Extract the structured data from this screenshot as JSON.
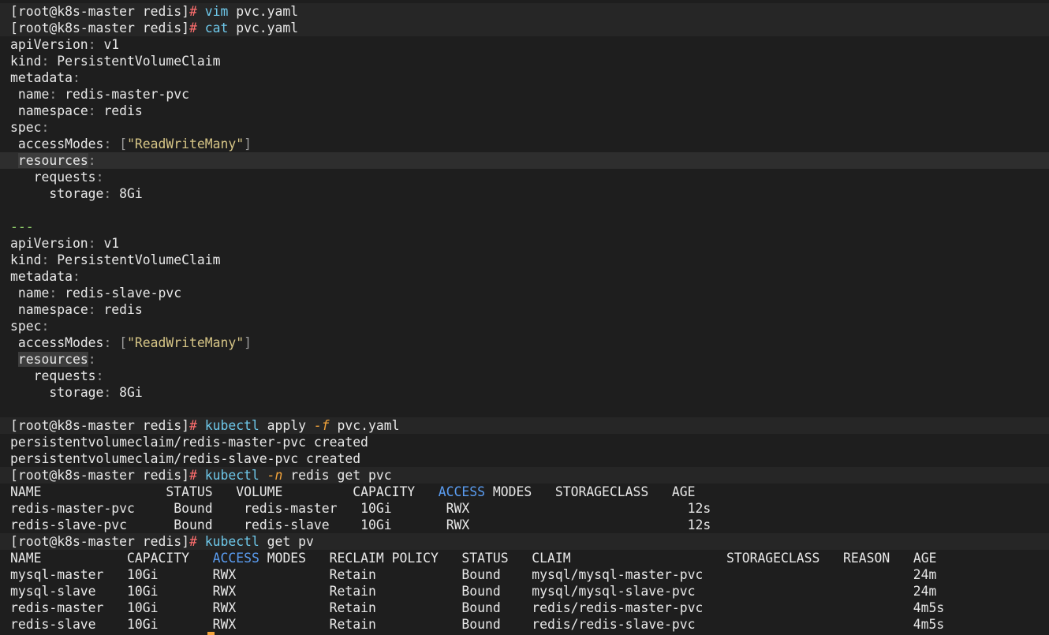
{
  "terminal": {
    "prompt": "[root@k8s-master redis]",
    "hash": "#",
    "cmd1": {
      "word": "vim",
      "arg": "pvc.yaml"
    },
    "cmd2": {
      "word": "cat",
      "arg": "pvc.yaml"
    },
    "doc1": {
      "apiVersion_key": "apiVersion",
      "apiVersion_val": "v1",
      "kind_key": "kind",
      "kind_val": "PersistentVolumeClaim",
      "metadata_key": "metadata",
      "name_key": "name",
      "name_val": "redis-master-pvc",
      "ns_key": "namespace",
      "ns_val": "redis",
      "spec_key": "spec",
      "am_key": "accessModes",
      "am_val": "\"ReadWriteMany\"",
      "res_key": "resources",
      "req_key": "requests",
      "storage_key": "storage",
      "storage_val": "8Gi"
    },
    "separator": "---",
    "doc2": {
      "apiVersion_key": "apiVersion",
      "apiVersion_val": "v1",
      "kind_key": "kind",
      "kind_val": "PersistentVolumeClaim",
      "metadata_key": "metadata",
      "name_key": "name",
      "name_val": "redis-slave-pvc",
      "ns_key": "namespace",
      "ns_val": "redis",
      "spec_key": "spec",
      "am_key": "accessModes",
      "am_val": "\"ReadWriteMany\"",
      "res_key": "resources",
      "req_key": "requests",
      "storage_key": "storage",
      "storage_val": "8Gi"
    },
    "cmd3": {
      "word": "kubectl",
      "sub": "apply",
      "flag": "-f",
      "arg": "pvc.yaml"
    },
    "out3": [
      "persistentvolumeclaim/redis-master-pvc created",
      "persistentvolumeclaim/redis-slave-pvc created"
    ],
    "cmd4": {
      "word": "kubectl",
      "flag": "-n",
      "arg": "redis get pvc"
    },
    "pvc_table": {
      "headers": {
        "name": "NAME",
        "status": "STATUS",
        "volume": "VOLUME",
        "capacity": "CAPACITY",
        "access": "ACCESS",
        "modes": "MODES",
        "storageclass": "STORAGECLASS",
        "age": "AGE"
      },
      "rows": [
        {
          "name": "redis-master-pvc",
          "status": "Bound",
          "volume": "redis-master",
          "capacity": "10Gi",
          "modes": "RWX",
          "storageclass": "",
          "age": "12s"
        },
        {
          "name": "redis-slave-pvc",
          "status": "Bound",
          "volume": "redis-slave",
          "capacity": "10Gi",
          "modes": "RWX",
          "storageclass": "",
          "age": "12s"
        }
      ]
    },
    "cmd5": {
      "word": "kubectl",
      "arg": "get pv"
    },
    "pv_table": {
      "headers": {
        "name": "NAME",
        "capacity": "CAPACITY",
        "access": "ACCESS",
        "modes": "MODES",
        "reclaim": "RECLAIM POLICY",
        "status": "STATUS",
        "claim": "CLAIM",
        "storageclass": "STORAGECLASS",
        "reason": "REASON",
        "age": "AGE"
      },
      "rows": [
        {
          "name": "mysql-master",
          "capacity": "10Gi",
          "modes": "RWX",
          "reclaim": "Retain",
          "status": "Bound",
          "claim": "mysql/mysql-master-pvc",
          "age": "24m"
        },
        {
          "name": "mysql-slave",
          "capacity": "10Gi",
          "modes": "RWX",
          "reclaim": "Retain",
          "status": "Bound",
          "claim": "mysql/mysql-slave-pvc",
          "age": "24m"
        },
        {
          "name": "redis-master",
          "capacity": "10Gi",
          "modes": "RWX",
          "reclaim": "Retain",
          "status": "Bound",
          "claim": "redis/redis-master-pvc",
          "age": "4m5s"
        },
        {
          "name": "redis-slave",
          "capacity": "10Gi",
          "modes": "RWX",
          "reclaim": "Retain",
          "status": "Bound",
          "claim": "redis/redis-slave-pvc",
          "age": "4m5s"
        }
      ]
    }
  }
}
